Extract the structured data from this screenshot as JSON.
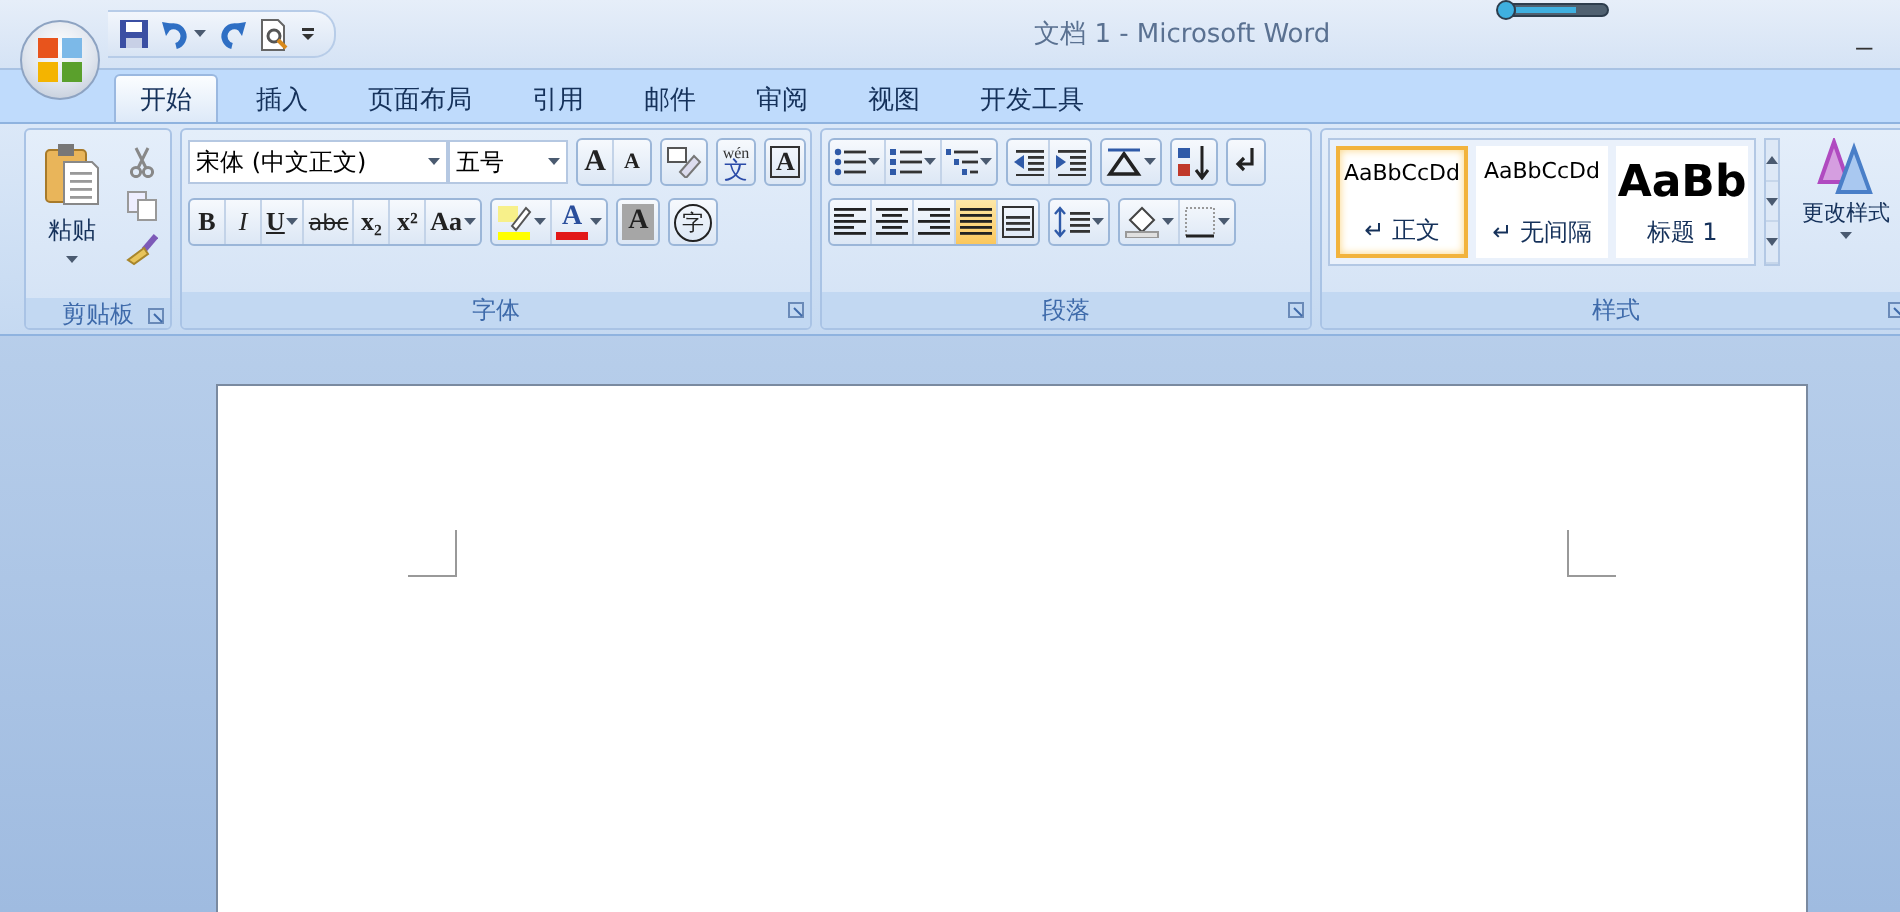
{
  "window": {
    "title": "文档 1 - Microsoft Word",
    "minimize": "_"
  },
  "tabs": [
    {
      "label": "开始",
      "selected": true
    },
    {
      "label": "插入",
      "selected": false
    },
    {
      "label": "页面布局",
      "selected": false
    },
    {
      "label": "引用",
      "selected": false
    },
    {
      "label": "邮件",
      "selected": false
    },
    {
      "label": "审阅",
      "selected": false
    },
    {
      "label": "视图",
      "selected": false
    },
    {
      "label": "开发工具",
      "selected": false
    }
  ],
  "clipboard": {
    "label": "剪贴板",
    "paste": "粘贴"
  },
  "font": {
    "label": "字体",
    "font_name": "宋体 (中文正文)",
    "font_size": "五号",
    "row_1": [
      "A",
      "A",
      "wén",
      "文",
      "A"
    ],
    "row_2": [
      "B",
      "I",
      "U",
      "abc",
      "x₂",
      "x²",
      "Aa",
      "A",
      "A",
      "字"
    ]
  },
  "paragraph": {
    "label": "段落",
    "row_1": [
      [
        {
          "selected": false
        },
        {
          "selected": false
        },
        {
          "selected": false
        }
      ],
      [
        {
          "selected": false
        },
        {
          "selected": false
        }
      ],
      [
        {
          "selected": false
        }
      ],
      [
        {
          "selected": false
        }
      ],
      [
        {
          "selected": false
        }
      ]
    ],
    "row_2": [
      [
        {
          "selected": false
        },
        {
          "selected": false
        },
        {
          "selected": false
        },
        {
          "selected": true
        },
        {
          "selected": false
        }
      ],
      [
        {
          "selected": false
        }
      ],
      [
        {
          "selected": false
        },
        {
          "selected": false
        }
      ]
    ]
  },
  "styles": {
    "label": "样式",
    "change": "更改样式",
    "items": [
      {
        "sample": "AaBbCcDd",
        "mark": "↵",
        "name": "正文",
        "kind": "normal",
        "selected": true
      },
      {
        "sample": "AaBbCcDd",
        "mark": "↵",
        "name": "无间隔",
        "kind": "normal",
        "selected": false
      },
      {
        "sample": "AaBb",
        "name": "标题 1",
        "kind": "heading",
        "selected": false
      }
    ]
  }
}
